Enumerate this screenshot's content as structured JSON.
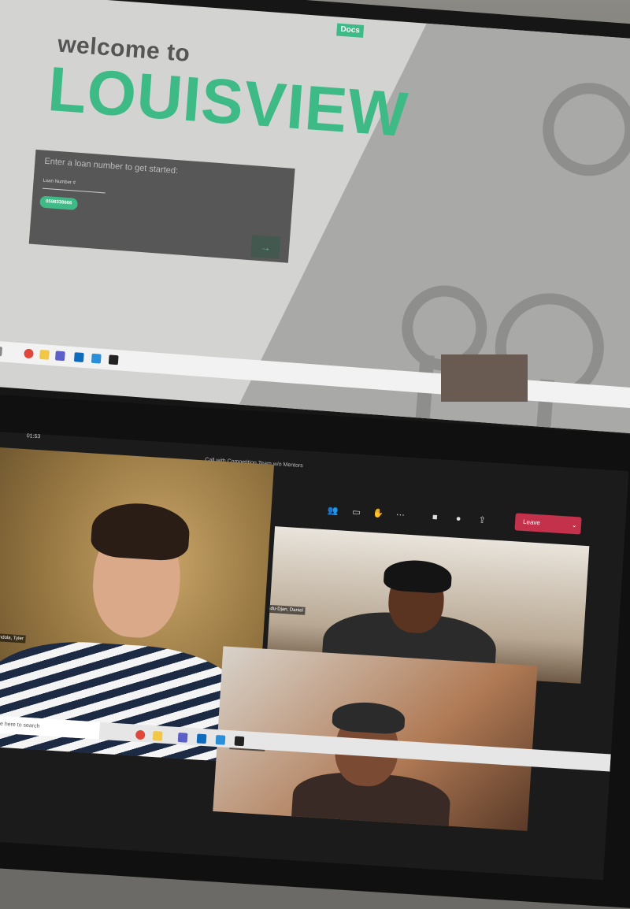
{
  "top_monitor": {
    "nav_tab": "Docs",
    "welcome": "welcome to",
    "brand": "LOUISVIEW",
    "loan_prompt": "Enter a loan number to get started:",
    "loan_field_label": "Loan Number #",
    "loan_value": "0598338666",
    "go_arrow": "→"
  },
  "laptop": {
    "call_time": "01:53",
    "call_title": "Call with Competition Team w/o Mentors",
    "leave_label": "Leave",
    "participants": [
      "Adu-Djan, Daniel",
      "Moore, Kaiden",
      "Mendola, Tyler"
    ],
    "taskbar_search": "Type here to search"
  },
  "colors": {
    "brand_green": "#3dba85",
    "leave_red": "#c4314b"
  }
}
